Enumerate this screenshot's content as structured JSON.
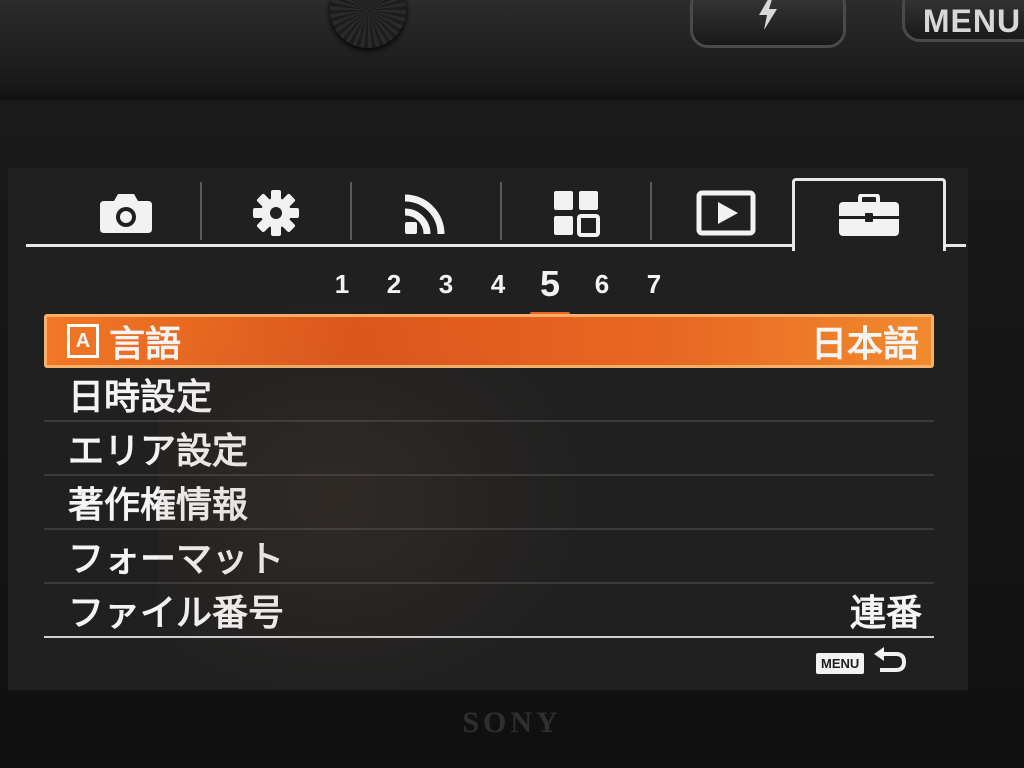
{
  "hardware": {
    "flash_icon": "flash-icon",
    "menu_button_label": "MENU",
    "brand": "SONY"
  },
  "tabs": [
    {
      "icon": "camera-icon",
      "active": false
    },
    {
      "icon": "gear-icon",
      "active": false
    },
    {
      "icon": "wireless-icon",
      "active": false
    },
    {
      "icon": "application-grid-icon",
      "active": false
    },
    {
      "icon": "playback-icon",
      "active": false
    },
    {
      "icon": "toolbox-icon",
      "active": true
    }
  ],
  "pages": {
    "items": [
      "1",
      "2",
      "3",
      "4",
      "5",
      "6",
      "7"
    ],
    "current": "5"
  },
  "menu": {
    "items": [
      {
        "label": "言語",
        "value": "日本語",
        "selected": true
      },
      {
        "label": "日時設定",
        "value": ""
      },
      {
        "label": "エリア設定",
        "value": ""
      },
      {
        "label": "著作権情報",
        "value": ""
      },
      {
        "label": "フォーマット",
        "value": ""
      },
      {
        "label": "ファイル番号",
        "value": "連番"
      }
    ],
    "language_icon_letter": "A"
  },
  "footer": {
    "menu_chip": "MENU",
    "back_icon": "return-arrow-icon"
  },
  "colors": {
    "accent": "#f0641e",
    "text": "#f4f4f4",
    "screen_bg": "#202020"
  }
}
